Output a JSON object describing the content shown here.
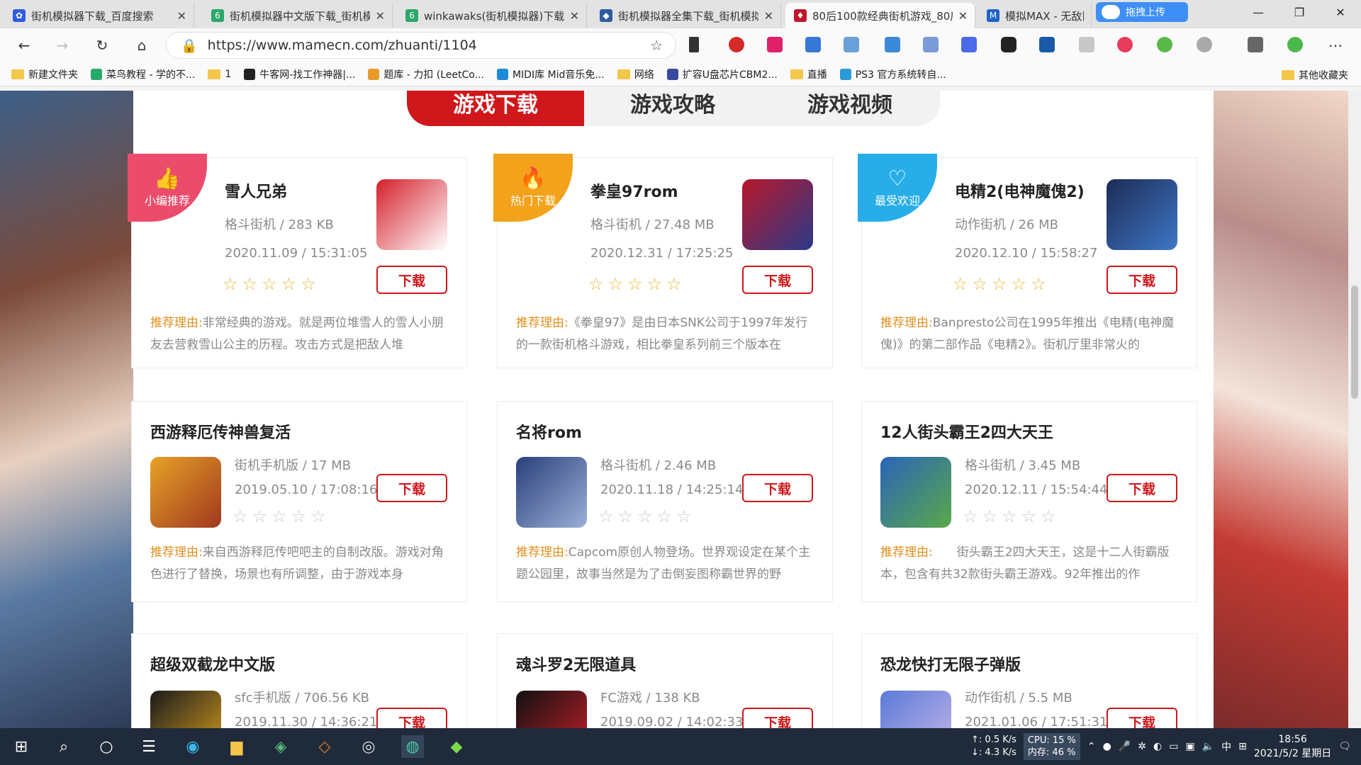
{
  "browser": {
    "tabs": [
      {
        "title": "街机模拟器下载_百度搜索",
        "fav_color": "#2f5ce0",
        "fav": "✿"
      },
      {
        "title": "街机模拟器中文版下载_街机模",
        "fav_color": "#2aa86a",
        "fav": "6"
      },
      {
        "title": "winkawaks(街机模拟器)下载",
        "fav_color": "#2aa86a",
        "fav": "6"
      },
      {
        "title": "街机模拟器全集下载_街机模拟",
        "fav_color": "#2f5ca0",
        "fav": "◆"
      },
      {
        "title": "80后100款经典街机游戏_80后",
        "fav_color": "#c0182a",
        "fav": "♦"
      },
      {
        "title": "模拟MAX - 无敌旧",
        "fav_color": "#1e62c8",
        "fav": "M"
      }
    ],
    "upload_label": "拖拽上传",
    "url": "https://www.mamecn.com/zhuanti/1104",
    "bookmarks": [
      "新建文件夹",
      "菜鸟教程 - 学的不...",
      "1",
      "牛客网-找工作神器|...",
      "题库 - 力扣 (LeetCo...",
      "MIDI库 Mid音乐免...",
      "网络",
      "扩容U盘芯片CBM2...",
      "直播",
      "PS3 官方系统转自..."
    ],
    "bookmarks_other": "其他收藏夹"
  },
  "page": {
    "tabs": [
      "游戏下载",
      "游戏攻略",
      "游戏视频"
    ],
    "download_label": "下载",
    "reason_label": "推荐理由:",
    "cards": [
      {
        "title": "雪人兄弟",
        "meta": "格斗街机 / 283 KB",
        "date": "2020.11.09 / 15:31:05",
        "reason": "非常经典的游戏。就是两位堆雪人的雪人小朋友去营救雪山公主的历程。攻击方式是把敌人堆",
        "badge": "小编推荐",
        "badge_icon": "👍",
        "badge_color": "#ec4c6c",
        "thumb_a": "#d41f2a",
        "thumb_b": "#ffffff",
        "rating": 0
      },
      {
        "title": "拳皇97rom",
        "meta": "格斗街机 / 27.48 MB",
        "date": "2020.12.31 / 17:25:25",
        "reason": "《拳皇97》是由日本SNK公司于1997年发行的一款街机格斗游戏，相比拳皇系列前三个版本在",
        "badge": "热门下载",
        "badge_icon": "🔥",
        "badge_color": "#f2a21b",
        "thumb_a": "#b8182a",
        "thumb_b": "#2a3a8a",
        "rating": 0
      },
      {
        "title": "电精2(电神魔傀2)",
        "meta": "动作街机 / 26 MB",
        "date": "2020.12.10 / 15:58:27",
        "reason": "Banpresto公司在1995年推出《电精(电神魔傀)》的第二部作品《电精2》。街机厅里非常火的",
        "badge": "最受欢迎",
        "badge_icon": "♡",
        "badge_color": "#27aee8",
        "thumb_a": "#1c2b55",
        "thumb_b": "#3f78c8",
        "rating": 0
      },
      {
        "title": "西游释厄传神兽复活",
        "meta": "街机手机版 / 17 MB",
        "date": "2019.05.10 / 17:08:16",
        "reason": "来自西游释厄传吧吧主的自制改版。游戏对角色进行了替换，场景也有所调整，由于游戏本身",
        "thumb_a": "#e7a226",
        "thumb_b": "#a0381f",
        "rating": 0
      },
      {
        "title": "名将rom",
        "meta": "格斗街机 / 2.46 MB",
        "date": "2020.11.18 / 14:25:14",
        "reason": "Capcom原创人物登场。世界观设定在某个主题公园里，故事当然是为了击倒妄图称霸世界的野",
        "thumb_a": "#2a3f7a",
        "thumb_b": "#9ab0d8",
        "rating": 0
      },
      {
        "title": "12人街头霸王2四大天王",
        "meta": "格斗街机 / 3.45 MB",
        "date": "2020.12.11 / 15:54:44",
        "reason": "　　街头霸王2四大天王，这是十二人街霸版本，包含有共32款街头霸王游戏。92年推出的作",
        "thumb_a": "#2a64b8",
        "thumb_b": "#5aa84a",
        "rating": 0
      },
      {
        "title": "超级双截龙中文版",
        "meta": "sfc手机版 / 706.56 KB",
        "date": "2019.11.30 / 14:36:21",
        "reason": "",
        "thumb_a": "#1a1a1a",
        "thumb_b": "#d8a020",
        "rating": 0
      },
      {
        "title": "魂斗罗2无限道具",
        "meta": "FC游戏 / 138 KB",
        "date": "2019.09.02 / 14:02:33",
        "reason": "",
        "thumb_a": "#111111",
        "thumb_b": "#c8202a",
        "rating": 0
      },
      {
        "title": "恐龙快打无限子弹版",
        "meta": "动作街机 / 5.5 MB",
        "date": "2021.01.06 / 17:51:31",
        "reason": "",
        "thumb_a": "#5a7ad8",
        "thumb_b": "#c8b8e8",
        "rating": 0
      }
    ]
  },
  "taskbar": {
    "net_up": "↑: 0.5 K/s",
    "net_down": "↓: 4.3 K/s",
    "cpu": "CPU: 15 %",
    "mem": "内存: 46 %",
    "ime": "中",
    "time": "18:56",
    "date": "2021/5/2 星期日"
  }
}
